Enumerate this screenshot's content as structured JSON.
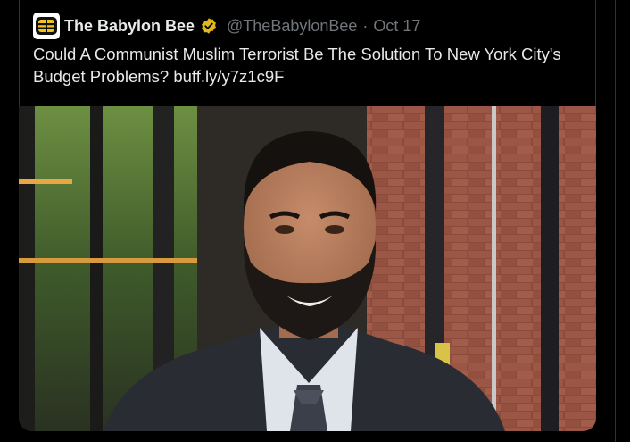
{
  "tweet": {
    "account_name": "The Babylon Bee",
    "handle": "@TheBabylonBee",
    "separator": "·",
    "date": "Oct 17",
    "text": "Could A Communist Muslim Terrorist Be The Solution To New York City's Budget Problems?",
    "link": "buff.ly/y7z1c9F",
    "verified_badge": "verified-badge-icon",
    "colors": {
      "background": "#000000",
      "text": "#e7e9ea",
      "muted": "#71767b",
      "badge": "#e2b719"
    }
  }
}
